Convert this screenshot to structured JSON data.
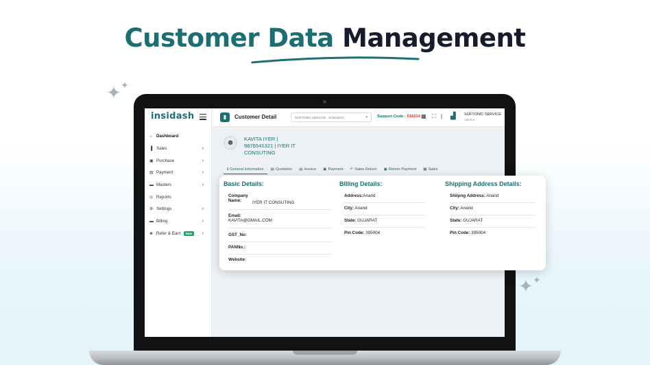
{
  "headline": {
    "part1": "Customer Data",
    "part2": "Management"
  },
  "brand": {
    "logo": "insidash",
    "accent": "#1b6f73"
  },
  "sidebar": {
    "items": [
      {
        "label": "Dashboard",
        "icon": "home-icon",
        "glyph": "⌂",
        "chevron": false,
        "active": true
      },
      {
        "label": "Sales",
        "icon": "chart-icon",
        "glyph": "▐",
        "chevron": true
      },
      {
        "label": "Purchase",
        "icon": "tag-icon",
        "glyph": "▣",
        "chevron": true
      },
      {
        "label": "Payment",
        "icon": "wallet-icon",
        "glyph": "▤",
        "chevron": true
      },
      {
        "label": "Masters",
        "icon": "bank-icon",
        "glyph": "▬",
        "chevron": true
      },
      {
        "label": "Reports",
        "icon": "users-icon",
        "glyph": "◎",
        "chevron": false
      },
      {
        "label": "Settings",
        "icon": "gear-icon",
        "glyph": "⚙",
        "chevron": true
      },
      {
        "label": "Billing",
        "icon": "card-icon",
        "glyph": "▬",
        "chevron": true
      },
      {
        "label": "Refer & Earn",
        "icon": "gift-icon",
        "glyph": "❀",
        "chevron": true,
        "badge": "New"
      }
    ]
  },
  "topbar": {
    "title": "Customer Detail",
    "service_select": "SOFTONIC SERVICE - SO516224",
    "support_label": "Support Code :",
    "support_code": "516224",
    "user_name": "SOFTONIC SERVICE",
    "user_role": "Admin"
  },
  "customer": {
    "line1": "KAVITA IYER |",
    "line2": "9876541321 | IYER IT",
    "line3": "CONSUTING"
  },
  "tabs": [
    {
      "label": "General Information",
      "glyph": "ℹ",
      "icon": "info-icon"
    },
    {
      "label": "Quotation",
      "glyph": "▤",
      "icon": "document-icon"
    },
    {
      "label": "Invoice",
      "glyph": "▤",
      "icon": "invoice-icon"
    },
    {
      "label": "Payment",
      "glyph": "▣",
      "icon": "payment-icon"
    },
    {
      "label": "Sales Return",
      "glyph": "↶",
      "icon": "return-icon"
    },
    {
      "label": "Return Payment",
      "glyph": "▣",
      "icon": "return-payment-icon"
    },
    {
      "label": "Sales",
      "glyph": "▦",
      "icon": "sales-icon"
    }
  ],
  "basic": {
    "title": "Basic Details:",
    "company_label_1": "Company",
    "company_label_2": "Name:",
    "company_value": "IYER IT CONSUTING",
    "email_label": "Email:",
    "email_value": "KAVITA@GMAIL.COM",
    "gst_label": "GST_No:",
    "pan_label": "PANNo.:",
    "website_label": "Website:"
  },
  "billing": {
    "title": "BIlling Details:",
    "address_label": "Address:",
    "address_value": "Anand",
    "city_label": "City:",
    "city_value": "Anand",
    "state_label": "State:",
    "state_value": "GUJARAT",
    "pin_label": "Pin Code:",
    "pin_value": "395004"
  },
  "shipping": {
    "title": "Shipping Address Details:",
    "address_label": "Shiipng Address:",
    "address_value": "Anand",
    "city_label": "City:",
    "city_value": "Anand",
    "state_label": "State:",
    "state_value": "GUJARAT",
    "pin_label": "Pin Code:",
    "pin_value": "395004"
  }
}
